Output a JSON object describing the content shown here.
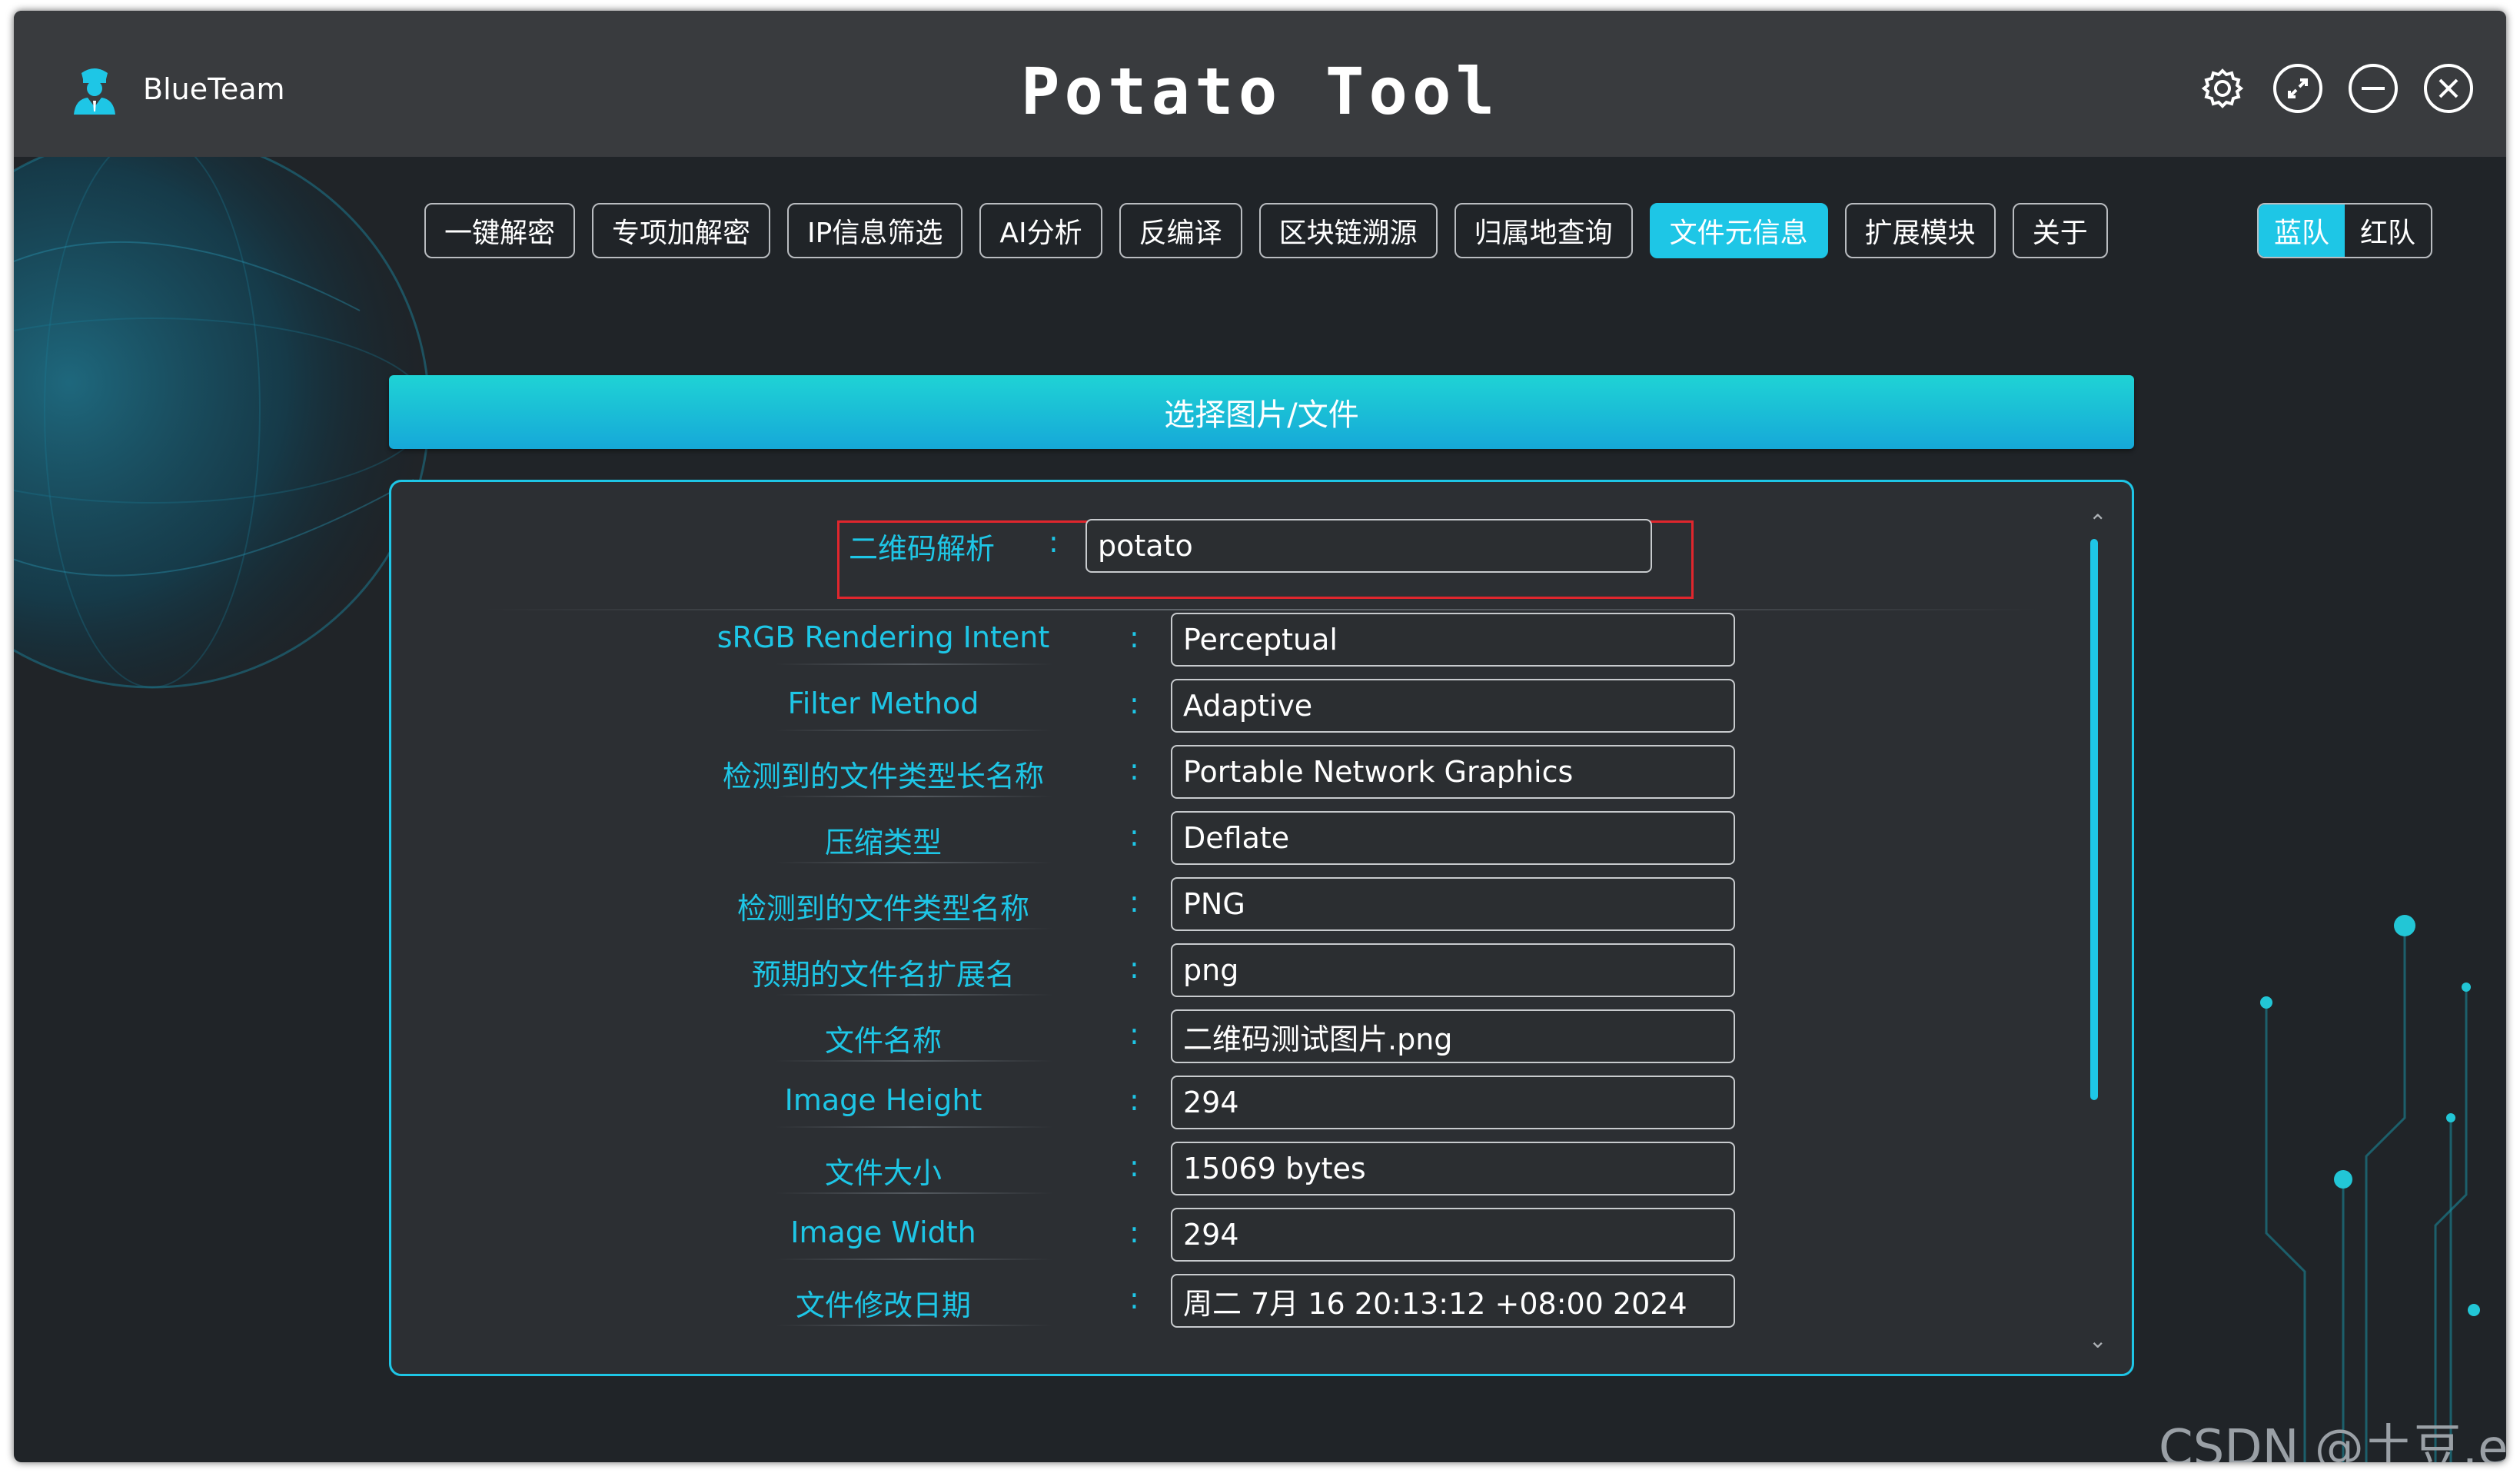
{
  "titlebar": {
    "brand": "BlueTeam",
    "app_title": "Potato Tool"
  },
  "nav": {
    "tabs": [
      {
        "label": "一键解密",
        "active": false
      },
      {
        "label": "专项加解密",
        "active": false
      },
      {
        "label": "IP信息筛选",
        "active": false
      },
      {
        "label": "AI分析",
        "active": false
      },
      {
        "label": "反编译",
        "active": false
      },
      {
        "label": "区块链溯源",
        "active": false
      },
      {
        "label": "归属地查询",
        "active": false
      },
      {
        "label": "文件元信息",
        "active": true
      },
      {
        "label": "扩展模块",
        "active": false
      },
      {
        "label": "关于",
        "active": false
      }
    ],
    "team": {
      "blue": "蓝队",
      "red": "红队",
      "active": "blue"
    }
  },
  "main": {
    "select_button": "选择图片/文件",
    "qr": {
      "label": "二维码解析",
      "colon": ":",
      "value": "potato"
    },
    "rows": [
      {
        "label": "sRGB Rendering Intent",
        "value": "Perceptual"
      },
      {
        "label": "Filter Method",
        "value": "Adaptive"
      },
      {
        "label": "检测到的文件类型长名称",
        "value": "Portable Network Graphics"
      },
      {
        "label": "压缩类型",
        "value": "Deflate"
      },
      {
        "label": "检测到的文件类型名称",
        "value": "PNG"
      },
      {
        "label": "预期的文件名扩展名",
        "value": "png"
      },
      {
        "label": "文件名称",
        "value": "二维码测试图片.png"
      },
      {
        "label": "Image Height",
        "value": "294"
      },
      {
        "label": "文件大小",
        "value": "15069 bytes"
      },
      {
        "label": "Image Width",
        "value": "294"
      },
      {
        "label": "文件修改日期",
        "value": "周二 7月 16 20:13:12 +08:00 2024"
      }
    ],
    "colon": ":"
  },
  "watermark": "CSDN @土豆.exe",
  "colors": {
    "accent": "#1ec6e6",
    "titlebar": "#393b3e",
    "background": "#202428",
    "highlight": "#e0262d"
  }
}
